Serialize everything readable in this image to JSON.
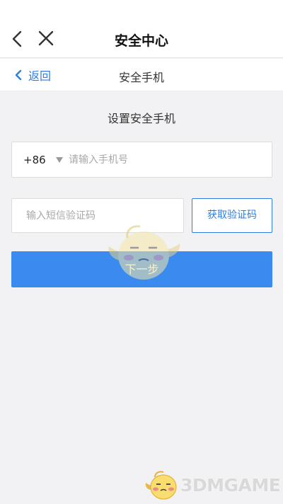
{
  "header": {
    "title": "安全中心",
    "back_icon": "chevron-left-icon",
    "close_icon": "close-icon"
  },
  "subheader": {
    "back_label": "返回",
    "title": "安全手机"
  },
  "form": {
    "heading": "设置安全手机",
    "country_code": "+86",
    "phone_placeholder": "请输入手机号",
    "sms_placeholder": "输入短信验证码",
    "get_code_label": "获取验证码",
    "next_label": "下一步"
  },
  "watermark": {
    "text": "3DMGAME"
  },
  "colors": {
    "accent": "#2f7de1",
    "primary_button": "#3a8af0",
    "background": "#f2f2f4"
  }
}
